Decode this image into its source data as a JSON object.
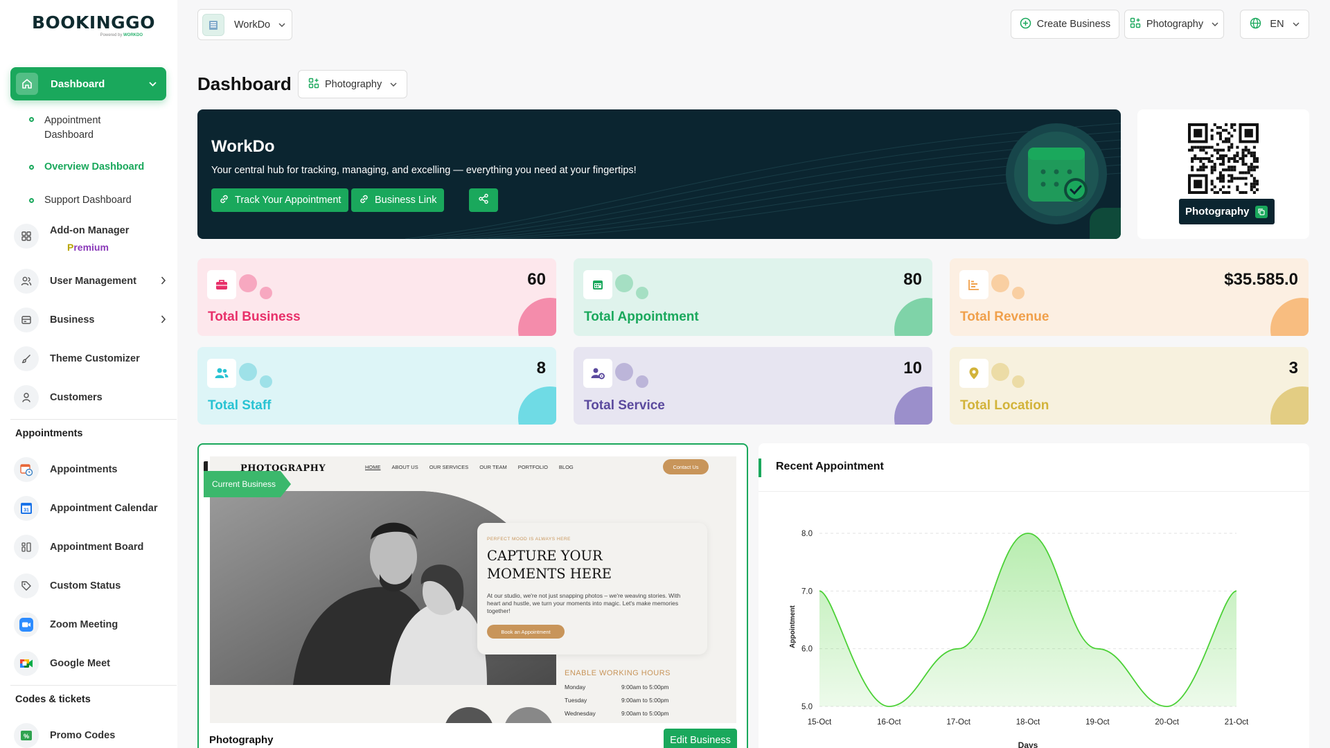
{
  "brand": {
    "logo": "BOOKINGGO",
    "powered_by": "Powered by",
    "powered_by_brand": "WORKDO"
  },
  "sidebar": {
    "dashboard": {
      "label": "Dashboard"
    },
    "sub_items": [
      {
        "label": "Appointment Dashboard"
      },
      {
        "label": "Overview Dashboard",
        "active": true
      },
      {
        "label": "Support Dashboard"
      }
    ],
    "addon": {
      "label": "Add-on Manager",
      "premium_p": "P",
      "premium_rest": "remium"
    },
    "items": [
      {
        "label": "User Management",
        "icon": "users-icon"
      },
      {
        "label": "Business",
        "icon": "business-card-icon"
      },
      {
        "label": "Theme Customizer",
        "icon": "brush-icon"
      },
      {
        "label": "Customers",
        "icon": "user-icon"
      }
    ],
    "section_appointments": "Appointments",
    "appointment_items": [
      {
        "label": "Appointments"
      },
      {
        "label": "Appointment Calendar"
      },
      {
        "label": "Appointment Board"
      },
      {
        "label": "Custom Status"
      },
      {
        "label": "Zoom Meeting"
      },
      {
        "label": "Google Meet"
      }
    ],
    "section_codes": "Codes & tickets",
    "codes_items": [
      {
        "label": "Promo Codes"
      }
    ]
  },
  "header": {
    "workspace": "WorkDo",
    "create_business": "Create Business",
    "business_select": "Photography",
    "language": "EN"
  },
  "page": {
    "title": "Dashboard",
    "business_filter": "Photography"
  },
  "hero": {
    "title": "WorkDo",
    "description": "Your central hub for tracking, managing, and excelling — everything you need at your fingertips!",
    "track_btn": "Track Your Appointment",
    "link_btn": "Business Link"
  },
  "qr": {
    "label": "Photography"
  },
  "stats": [
    {
      "label": "Total Business",
      "value": "60",
      "color": "#e8306a"
    },
    {
      "label": "Total Appointment",
      "value": "80",
      "color": "#1aa85c"
    },
    {
      "label": "Total Revenue",
      "value": "$35.585.0",
      "color": "#f0a04b"
    },
    {
      "label": "Total Staff",
      "value": "8",
      "color": "#29c3d3"
    },
    {
      "label": "Total Service",
      "value": "10",
      "color": "#5b4a9e"
    },
    {
      "label": "Total Location",
      "value": "3",
      "color": "#d2b33a"
    }
  ],
  "business_card": {
    "badge": "Current Business",
    "name": "Photography",
    "edit_btn": "Edit Business",
    "preview": {
      "brand": "PHOTOGRAPHY",
      "nav": [
        "HOME",
        "ABOUT US",
        "OUR SERVICES",
        "OUR TEAM",
        "PORTFOLIO",
        "BLOG"
      ],
      "contact": "Contact Us",
      "kicker": "PERFECT MOOD IS ALWAYS HERE",
      "headline": "CAPTURE YOUR MOMENTS HERE",
      "paragraph": "At our studio, we're not just snapping photos – we're weaving stories. With heart and hustle, we turn your moments into magic. Let's make memories together!",
      "book_btn": "Book an Appointment",
      "hours_title": "ENABLE WORKING HOURS",
      "hours": [
        {
          "day": "Monday",
          "time": "9:00am to 5:00pm"
        },
        {
          "day": "Tuesday",
          "time": "9:00am to 5:00pm"
        },
        {
          "day": "Wednesday",
          "time": "9:00am to 5:00pm"
        }
      ]
    }
  },
  "recent": {
    "title": "Recent Appointment"
  },
  "chart_data": {
    "type": "area",
    "x": [
      "15-Oct",
      "16-Oct",
      "17-Oct",
      "18-Oct",
      "19-Oct",
      "20-Oct",
      "21-Oct"
    ],
    "series": [
      {
        "values": [
          7.0,
          5.0,
          6.0,
          8.0,
          6.0,
          5.0,
          7.0
        ]
      }
    ],
    "xlabel": "Days",
    "ylabel": "Appointment",
    "ylim": [
      5.0,
      8.0
    ],
    "yticks": [
      "8.0",
      "7.0",
      "6.0",
      "5.0"
    ],
    "line_color": "#4cd137",
    "grid": true
  }
}
